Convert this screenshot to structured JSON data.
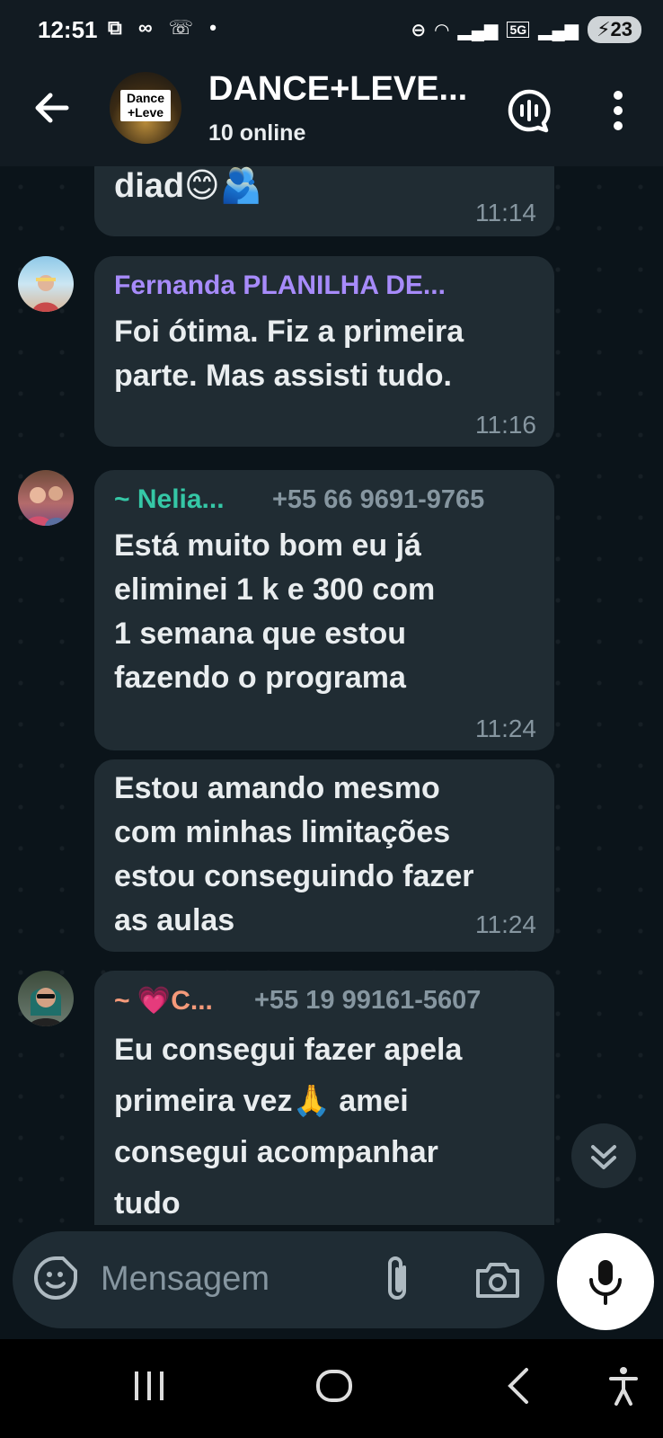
{
  "status_bar": {
    "time": "12:51",
    "icons": [
      "screen-record-icon",
      "link-icon",
      "missed-call-icon",
      "dot-icon"
    ],
    "right_icons": [
      "do-not-disturb-icon",
      "wifi-icon",
      "signal-icon",
      "5g-icon",
      "signal-icon"
    ],
    "network": "5G",
    "battery": "23"
  },
  "header": {
    "group_name": "DANCE+LEVE...",
    "subtitle": "10 online",
    "avatar_text_line1": "Dance",
    "avatar_text_line2": "+Leve"
  },
  "messages": [
    {
      "text": "diad😊🫂",
      "time": "11:14"
    },
    {
      "sender": "Fernanda PLANILHA DE...",
      "sender_color": "#a78bfa",
      "text_lines": [
        "Foi ótima.  Fiz a primeira",
        "parte.  Mas assisti tudo."
      ],
      "time": "11:16"
    },
    {
      "sender": "~ Nelia...",
      "sender_color": "#35c7a6",
      "phone": "+55 66 9691-9765",
      "text_lines": [
        "Está muito bom eu já",
        "eliminei 1 k e 300 com",
        "1 semana que estou",
        "fazendo o programa"
      ],
      "time": "11:24"
    },
    {
      "text_lines": [
        "Estou amando mesmo",
        "com minhas limitações",
        "estou conseguindo fazer",
        "as aulas"
      ],
      "time": "11:24"
    },
    {
      "sender": "~ 💗C...",
      "sender_color": "#f59a7a",
      "phone": "+55 19 99161-5607",
      "text_lines": [
        "Eu consegui fazer apela",
        "primeira vez🙏 amei",
        "consegui acompanhar",
        "tudo"
      ]
    }
  ],
  "composer": {
    "placeholder": "Mensagem"
  },
  "colors": {
    "background": "#0b141a",
    "bubble": "#202c33",
    "header": "#121b22",
    "meta_text": "#8696a0"
  }
}
